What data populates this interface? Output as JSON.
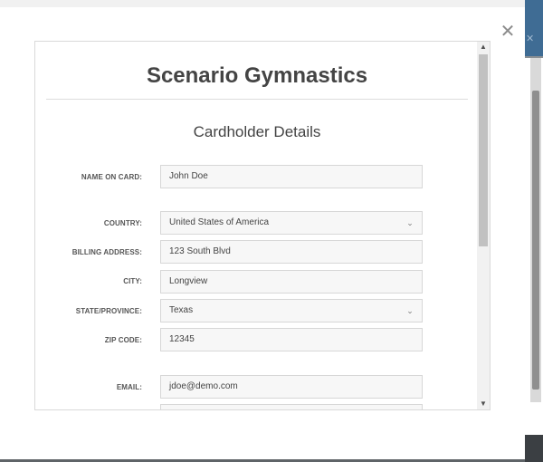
{
  "modal": {
    "close_glyph": "✕"
  },
  "store": {
    "title": "Scenario Gymnastics"
  },
  "section": {
    "title": "Cardholder Details"
  },
  "form": {
    "name_label": "NAME ON CARD:",
    "name_value": "John Doe",
    "country_label": "COUNTRY:",
    "country_value": "United States of America",
    "address_label": "BILLING ADDRESS:",
    "address_value": "123 South Blvd",
    "city_label": "CITY:",
    "city_value": "Longview",
    "state_label": "STATE/PROVINCE:",
    "state_value": "Texas",
    "zip_label": "ZIP CODE:",
    "zip_value": "12345",
    "email_label": "EMAIL:",
    "email_value": "jdoe@demo.com"
  },
  "icons": {
    "select_chevron": "chevron-down-icon",
    "scroll_up": "triangle-up-icon",
    "scroll_down": "triangle-down-icon"
  },
  "colors": {
    "title_text": "#444444",
    "field_bg": "#f7f7f7",
    "field_border": "#d7d7d7",
    "background_bar": "#3f6c94"
  }
}
